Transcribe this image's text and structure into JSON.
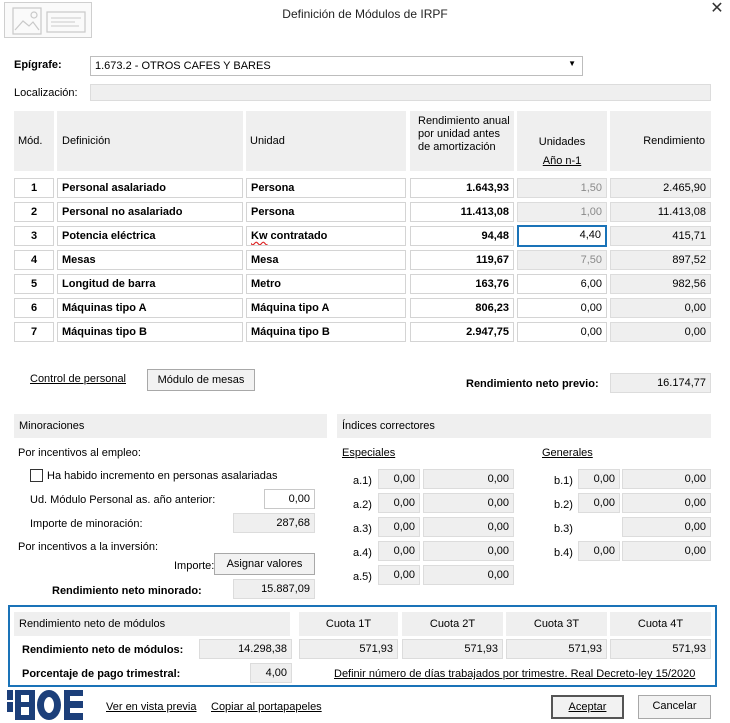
{
  "window": {
    "title": "Definición de Módulos de IRPF",
    "close_glyph": "✕"
  },
  "epigrafe": {
    "label": "Epígrafe:",
    "value": "1.673.2 - OTROS CAFES Y BARES"
  },
  "localizacion": {
    "label": "Localización:",
    "value": ""
  },
  "table": {
    "headers": {
      "mod": "Mód.",
      "definicion": "Definición",
      "unidad": "Unidad",
      "rendimiento_unidad": "Rendimiento anual por unidad antes de amortización",
      "unidades": "Unidades",
      "unidades_sub": "Año n-1",
      "rendimiento": "Rendimiento"
    },
    "rows": [
      {
        "mod": "1",
        "definicion": "Personal asalariado",
        "unidad": "Persona",
        "rend_unidad": "1.643,93",
        "unidades": "1,50",
        "rendimiento": "2.465,90"
      },
      {
        "mod": "2",
        "definicion": "Personal no asalariado",
        "unidad": "Persona",
        "rend_unidad": "11.413,08",
        "unidades": "1,00",
        "rendimiento": "11.413,08"
      },
      {
        "mod": "3",
        "definicion": "Potencia eléctrica",
        "unidad": "Kw contratado",
        "rend_unidad": "94,48",
        "unidades": "4,40",
        "rendimiento": "415,71"
      },
      {
        "mod": "4",
        "definicion": "Mesas",
        "unidad": "Mesa",
        "rend_unidad": "119,67",
        "unidades": "7,50",
        "rendimiento": "897,52"
      },
      {
        "mod": "5",
        "definicion": "Longitud de barra",
        "unidad": "Metro",
        "rend_unidad": "163,76",
        "unidades": "6,00",
        "rendimiento": "982,56"
      },
      {
        "mod": "6",
        "definicion": "Máquinas tipo A",
        "unidad": "Máquina tipo A",
        "rend_unidad": "806,23",
        "unidades": "0,00",
        "rendimiento": "0,00"
      },
      {
        "mod": "7",
        "definicion": "Máquinas tipo B",
        "unidad": "Máquina tipo B",
        "rend_unidad": "2.947,75",
        "unidades": "0,00",
        "rendimiento": "0,00"
      }
    ]
  },
  "control_personal_link": "Control de personal",
  "modulo_mesas_button": "Módulo de mesas",
  "rendimiento_neto_previo": {
    "label": "Rendimiento neto previo:",
    "value": "16.174,77"
  },
  "minoraciones": {
    "title": "Minoraciones",
    "incentivos_empleo": "Por incentivos al empleo:",
    "checkbox_label": "Ha habido incremento en personas asalariadas",
    "ud_modulo_label": "Ud. Módulo Personal as. año anterior:",
    "ud_modulo_value": "0,00",
    "importe_minoracion_label": "Importe de minoración:",
    "importe_minoracion_value": "287,68",
    "incentivos_inversion": "Por incentivos a la inversión:",
    "importe_label": "Importe:",
    "asignar_button": "Asignar valores",
    "rend_minorado_label": "Rendimiento neto minorado:",
    "rend_minorado_value": "15.887,09"
  },
  "indices": {
    "title": "Índices correctores",
    "especiales_title": "Especiales",
    "generales_title": "Generales",
    "especiales": [
      {
        "label": "a.1)",
        "v1": "0,00",
        "v2": "0,00"
      },
      {
        "label": "a.2)",
        "v1": "0,00",
        "v2": "0,00"
      },
      {
        "label": "a.3)",
        "v1": "0,00",
        "v2": "0,00"
      },
      {
        "label": "a.4)",
        "v1": "0,00",
        "v2": "0,00"
      },
      {
        "label": "a.5)",
        "v1": "0,00",
        "v2": "0,00"
      }
    ],
    "generales": [
      {
        "label": "b.1)",
        "v1": "0,00",
        "v2": "0,00"
      },
      {
        "label": "b.2)",
        "v1": "0,00",
        "v2": "0,00"
      },
      {
        "label": "b.3)",
        "v1": "",
        "v2": "0,00"
      },
      {
        "label": "b.4)",
        "v1": "0,00",
        "v2": "0,00"
      }
    ]
  },
  "modulos": {
    "title": "Rendimiento neto de módulos",
    "cuotas": [
      "Cuota 1T",
      "Cuota 2T",
      "Cuota 3T",
      "Cuota 4T"
    ],
    "rend_label": "Rendimiento neto de módulos:",
    "rend_value": "14.298,38",
    "cuota_values": [
      "571,93",
      "571,93",
      "571,93",
      "571,93"
    ],
    "porcentaje_label": "Porcentaje de pago trimestral:",
    "porcentaje_value": "4,00",
    "definir_link": "Definir número de días trabajados por trimestre. Real Decreto-ley 15/2020"
  },
  "footer": {
    "logo_text": "BOE",
    "vista_previa": "Ver en vista previa",
    "copiar": "Copiar al portapapeles",
    "aceptar": "Aceptar",
    "cancelar": "Cancelar"
  },
  "colors": {
    "accent": "#1a73b8",
    "panel_grey": "#efefef",
    "logo_blue": "#1c3f7a"
  }
}
